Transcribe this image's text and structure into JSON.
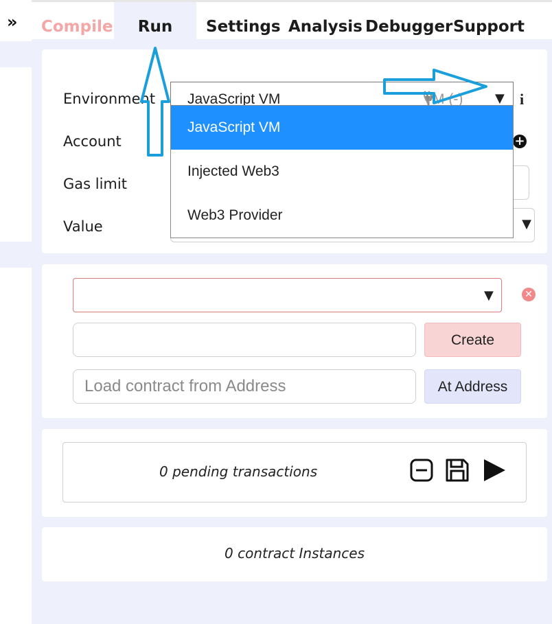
{
  "nav": {
    "expand_icon": "double-chevron-right-icon",
    "tabs": [
      {
        "label": "Compile"
      },
      {
        "label": "Run"
      },
      {
        "label": "Settings"
      },
      {
        "label": "Analysis"
      },
      {
        "label": "Debugger"
      },
      {
        "label": "Support"
      }
    ],
    "active_tab": "Run"
  },
  "environment_panel": {
    "environment_label": "Environment",
    "account_label": "Account",
    "gas_limit_label": "Gas limit",
    "value_label": "Value",
    "environment_value": "JavaScript VM",
    "vm_tag": "VM (-)",
    "dropdown_options": [
      "JavaScript VM",
      "Injected Web3",
      "Web3 Provider"
    ],
    "selected_option": "JavaScript VM"
  },
  "contract_panel": {
    "create_label": "Create",
    "address_placeholder": "Load contract from Address",
    "at_address_label": "At Address"
  },
  "transactions": {
    "pending_text": "0 pending transactions"
  },
  "instances": {
    "text": "0 contract Instances"
  },
  "colors": {
    "accent_blue": "#1e90ff",
    "annotation_arrow": "#1a9fdb",
    "compile_tab": "#f4a7a7",
    "create_button": "#f8d4d4"
  }
}
